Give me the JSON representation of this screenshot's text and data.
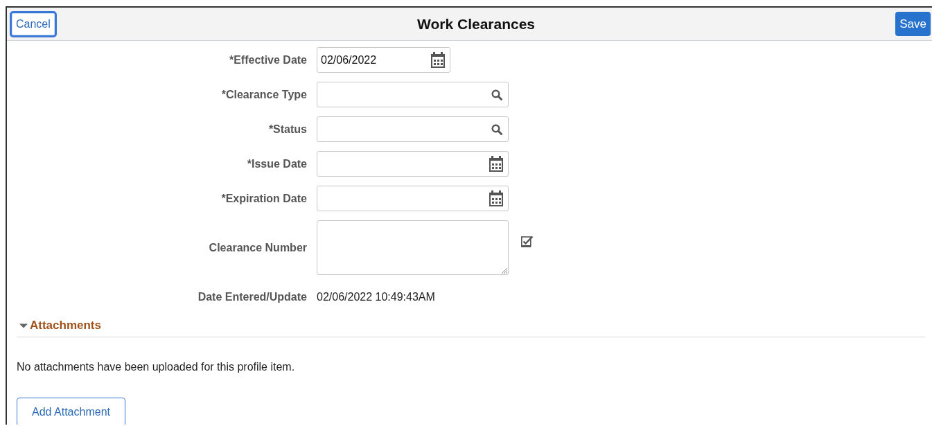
{
  "header": {
    "cancel": "Cancel",
    "title": "Work Clearances",
    "save": "Save"
  },
  "fields": [
    {
      "label": "*Effective Date",
      "kind": "date",
      "value": "02/06/2022"
    },
    {
      "label": "*Clearance Type",
      "kind": "prompt"
    },
    {
      "label": "*Status",
      "kind": "prompt"
    },
    {
      "label": "*Issue Date",
      "kind": "date"
    },
    {
      "label": "*Expiration Date",
      "kind": "date"
    },
    {
      "label": "Clearance Number",
      "kind": "textarea"
    },
    {
      "label": "Date Entered/Update",
      "kind": "display",
      "value": "02/06/2022 10:49:43AM"
    }
  ],
  "attachments": {
    "title": "Attachments",
    "expanded": true,
    "message": "No attachments have been uploaded for this profile item.",
    "button": "Add Attachment"
  }
}
